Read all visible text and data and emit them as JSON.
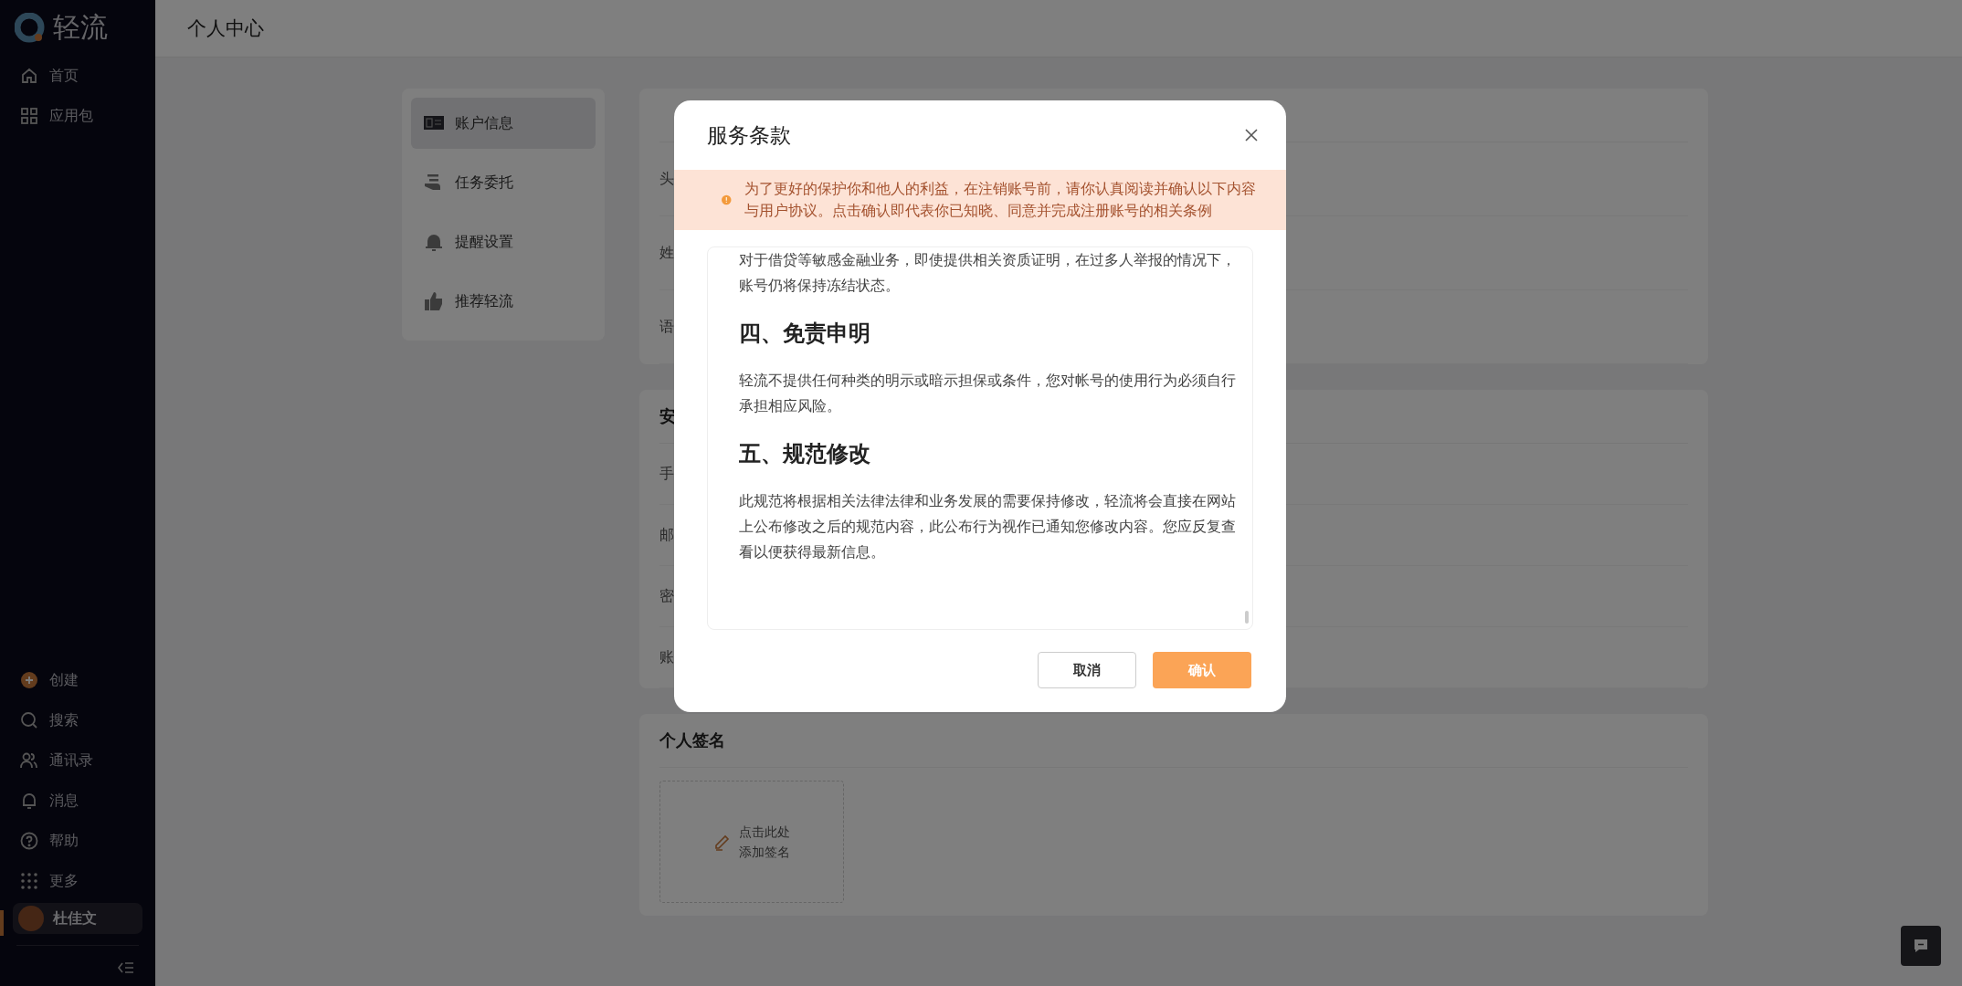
{
  "brand": {
    "name": "轻流"
  },
  "nav_top": [
    {
      "label": "首页"
    },
    {
      "label": "应用包"
    }
  ],
  "nav_bottom": [
    {
      "label": "创建"
    },
    {
      "label": "搜索"
    },
    {
      "label": "通讯录"
    },
    {
      "label": "消息"
    },
    {
      "label": "帮助"
    },
    {
      "label": "更多"
    }
  ],
  "user": {
    "name": "杜佳文",
    "selected": true
  },
  "page_title": "个人中心",
  "settings_menu": [
    {
      "label": "账户信息",
      "selected": true
    },
    {
      "label": "任务委托",
      "selected": false
    },
    {
      "label": "提醒设置",
      "selected": false
    },
    {
      "label": "推荐轻流",
      "selected": false
    }
  ],
  "sections": [
    {
      "rows": [
        "头",
        "姓",
        "语"
      ]
    },
    {
      "heading": "安",
      "rows": [
        "手",
        "邮",
        "密",
        "账"
      ]
    }
  ],
  "signature": {
    "heading": "个人签名",
    "hint": [
      "点击此处",
      "添加签名"
    ]
  },
  "dialog": {
    "title": "服务条款",
    "notice": "为了更好的保护你和他人的利益，在注销账号前，请你认真阅读并确认以下内容与用户协议。点击确认即代表你已知晓、同意并完成注册账号的相关条例",
    "content": [
      {
        "kind": "paragraph",
        "text": "对于借贷等敏感金融业务，即使提供相关资质证明，在过多人举报的情况下，账号仍将保持冻结状态。"
      },
      {
        "kind": "heading",
        "text": "四、免责申明"
      },
      {
        "kind": "paragraph",
        "text": "轻流不提供任何种类的明示或暗示担保或条件，您对帐号的使用行为必须自行承担相应风险。"
      },
      {
        "kind": "heading",
        "text": "五、规范修改"
      },
      {
        "kind": "paragraph",
        "text": "此规范将根据相关法律法律和业务发展的需要保持修改，轻流将会直接在网站上公布修改之后的规范内容，此公布行为视作已通知您修改内容。您应反复查看以便获得最新信息。"
      }
    ],
    "buttons": [
      {
        "label": "取消",
        "kind": "secondary"
      },
      {
        "label": "确认",
        "kind": "primary"
      }
    ]
  }
}
